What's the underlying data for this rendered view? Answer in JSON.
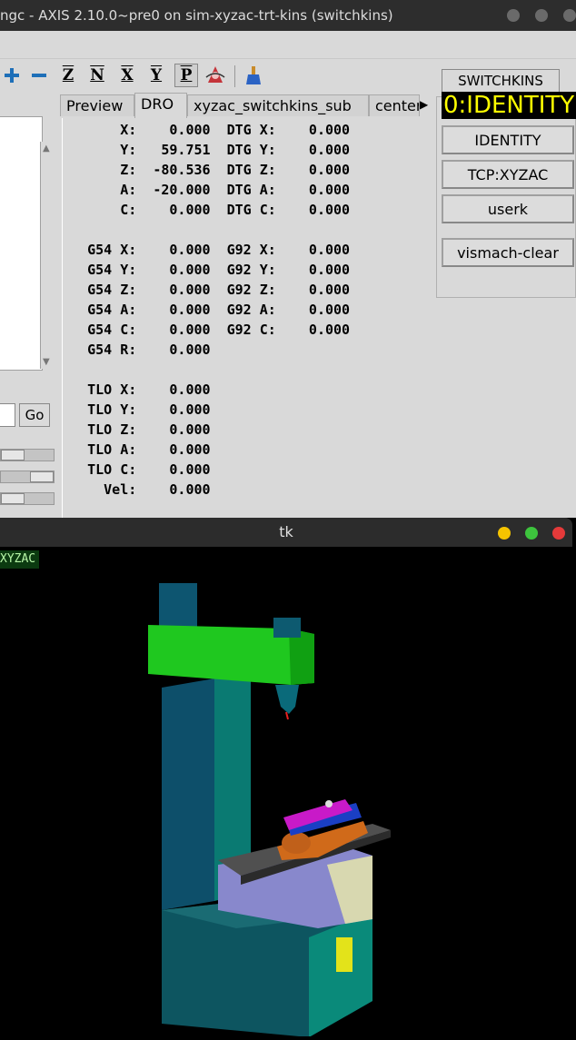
{
  "axis": {
    "title": "ngc - AXIS 2.10.0~pre0 on sim-xyzac-trt-kins (switchkins)",
    "toolbar": {
      "z": "Z",
      "n": "N",
      "x": "X",
      "y": "Y",
      "p": "P"
    },
    "go_label": "Go",
    "tabs": [
      "Preview",
      "DRO",
      "xyzac_switchkins_sub",
      "center"
    ],
    "active_tab": "DRO",
    "dro_lines": [
      "       X:    0.000  DTG X:    0.000",
      "       Y:   59.751  DTG Y:    0.000",
      "       Z:  -80.536  DTG Z:    0.000",
      "       A:  -20.000  DTG A:    0.000",
      "       C:    0.000  DTG C:    0.000",
      "",
      "   G54 X:    0.000  G92 X:    0.000",
      "   G54 Y:    0.000  G92 Y:    0.000",
      "   G54 Z:    0.000  G92 Z:    0.000",
      "   G54 A:    0.000  G92 A:    0.000",
      "   G54 C:    0.000  G92 C:    0.000",
      "   G54 R:    0.000",
      "",
      "   TLO X:    0.000",
      "   TLO Y:    0.000",
      "   TLO Z:    0.000",
      "   TLO A:    0.000",
      "   TLO C:    0.000",
      "     Vel:    0.000"
    ]
  },
  "switchkins": {
    "header": "SWITCHKINS",
    "status": "0:IDENTITY",
    "buttons": [
      "IDENTITY",
      "TCP:XYZAC",
      "userk"
    ],
    "clear": "vismach-clear"
  },
  "tk": {
    "title": "tk",
    "mode": "XYZAC"
  },
  "colors": {
    "status_bg": "#000000",
    "status_fg": "#ffff00",
    "mode_fg": "#b6f5a6",
    "dot_yellow": "#f5c400",
    "dot_green": "#3dc43d",
    "dot_red": "#e53a3a"
  }
}
